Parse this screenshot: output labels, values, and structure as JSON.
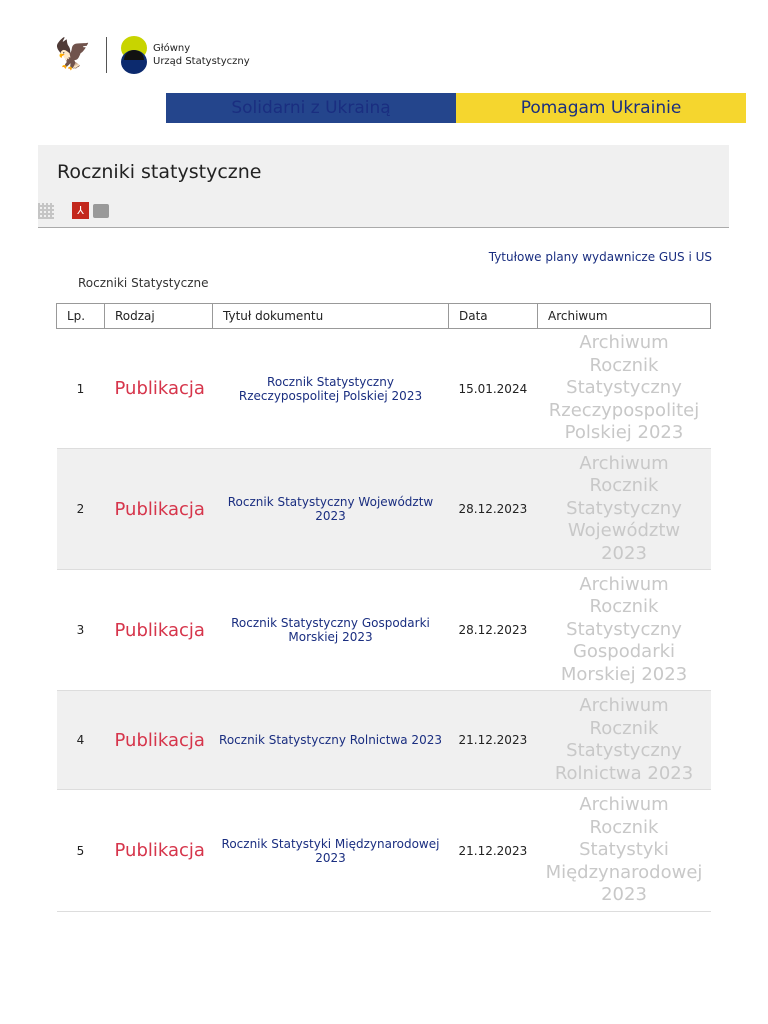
{
  "logo": {
    "line1": "Główny",
    "line2": "Urząd Statystyczny"
  },
  "banner": {
    "left": "Solidarni z Ukrainą",
    "right": "Pomagam Ukrainie"
  },
  "page": {
    "title": "Roczniki statystyczne",
    "top_link": "Tytułowe plany wydawnicze GUS i  US",
    "caption": "Roczniki Statystyczne"
  },
  "table": {
    "headers": [
      "Lp.",
      "Rodzaj",
      "Tytuł dokumentu",
      "Data",
      "Archiwum"
    ],
    "rows": [
      {
        "lp": "1",
        "rodzaj": "Publikacja",
        "tytul": "Rocznik Statystyczny Rzeczypospolitej Polskiej 2023",
        "data": "15.01.2024",
        "archiwum": "Archiwum Rocznik Statystyczny Rzeczypospolitej Polskiej 2023"
      },
      {
        "lp": "2",
        "rodzaj": "Publikacja",
        "tytul": "Rocznik Statystyczny Województw 2023",
        "data": "28.12.2023",
        "archiwum": "Archiwum Rocznik Statystyczny Województw 2023"
      },
      {
        "lp": "3",
        "rodzaj": "Publikacja",
        "tytul": "Rocznik Statystyczny Gospodarki Morskiej 2023",
        "data": "28.12.2023",
        "archiwum": "Archiwum Rocznik Statystyczny Gospodarki Morskiej 2023"
      },
      {
        "lp": "4",
        "rodzaj": "Publikacja",
        "tytul": "Rocznik Statystyczny Rolnictwa 2023",
        "data": "21.12.2023",
        "archiwum": "Archiwum Rocznik Statystyczny Rolnictwa 2023"
      },
      {
        "lp": "5",
        "rodzaj": "Publikacja",
        "tytul": "Rocznik Statystyki Międzynarodowej 2023",
        "data": "21.12.2023",
        "archiwum": "Archiwum Rocznik Statystyki Międzynarodowej 2023"
      }
    ]
  }
}
